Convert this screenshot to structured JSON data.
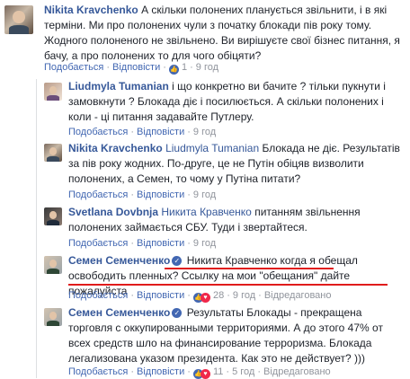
{
  "comments": [
    {
      "author": "Nikita Kravchenko",
      "text": "А скільки полонених планується звільнити, і в які терміни. Ми про полонених чули з початку блокади пів року тому. Жодного полоненого не звільнено. Ви вирішуєте свої бізнес питання, я бачу, а про полонених то для чого обіцяти?",
      "like": "Подобається",
      "reply": "Відповісти",
      "likes": "1",
      "time": "9 год"
    },
    {
      "author": "Liudmyla Tumanian",
      "text": "і що конкретно ви бачите ? тільки пукнути і замовкнути ? Блокада діє і посилюється. А скільки полонених і коли - ці питання задавайте Путлеру.",
      "like": "Подобається",
      "reply": "Відповісти",
      "time": "9 год"
    },
    {
      "author": "Nikita Kravchenko",
      "reply_to": "Liudmyla Tumanian",
      "text": "Блокада не діє. Результатів за пів року жодних. По-друге, це не Путін обіцяв визволити полонених, а Семен, то чому у Путіна питати?",
      "like": "Подобається",
      "reply": "Відповісти",
      "time": "9 год"
    },
    {
      "author": "Svetlana Dovbnja",
      "reply_to": "Никита Кравченко",
      "text": "питанням звільнення полонених займається СБУ. Туди і звертайтеся.",
      "like": "Подобається",
      "reply": "Відповісти",
      "time": "9 год"
    },
    {
      "author": "Семен Семенченко",
      "text": "Никита Кравченко когда я обещал освободить пленных? Ссылку на мои \"обещания\" дайте пожалуйста",
      "like": "Подобається",
      "reply": "Відповісти",
      "likes": "28",
      "time": "9 год",
      "edited": "Відредаговано"
    },
    {
      "author": "Семен Семенченко",
      "text": "Результаты Блокады - прекращена торговля с оккупированными территориями. А до этого 47% от всех средств шло на финансирование терроризма. Блокада легализована указом президента. Как это не действует? )))",
      "like": "Подобається",
      "reply": "Відповісти",
      "likes": "11",
      "time": "5 год",
      "edited": "Відредаговано"
    }
  ],
  "icons": {
    "verified": "verified-badge-icon",
    "like": "like-thumb-icon",
    "love": "heart-reaction-icon"
  },
  "colors": {
    "link": "#365899",
    "meta": "#90949c",
    "highlight": "#e01b1b"
  }
}
